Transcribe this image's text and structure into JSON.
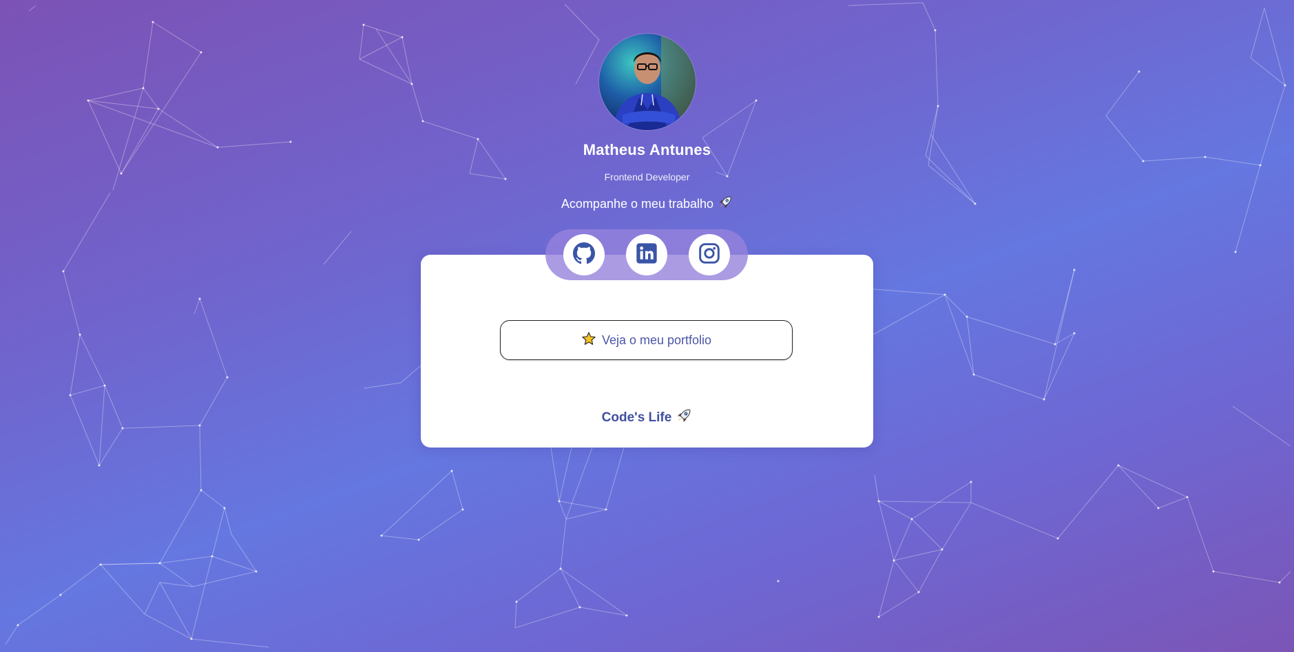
{
  "profile": {
    "name": "Matheus Antunes",
    "role": "Frontend Developer",
    "tagline": "Acompanhe o meu trabalho",
    "tagline_icon": "rocket-icon"
  },
  "social": {
    "items": [
      {
        "name": "github",
        "icon": "github-icon"
      },
      {
        "name": "linkedin",
        "icon": "linkedin-icon"
      },
      {
        "name": "instagram",
        "icon": "instagram-icon"
      }
    ]
  },
  "links": {
    "portfolio_label": "Veja o meu portfolio",
    "portfolio_icon": "star-icon"
  },
  "footer": {
    "text": "Code's Life",
    "icon": "rocket-icon"
  },
  "colors": {
    "gradient_start": "#7c52b5",
    "gradient_mid": "#6577e0",
    "link_text": "#4a55a8",
    "footer_text": "#3f4fa0",
    "card_bg": "#ffffff"
  }
}
